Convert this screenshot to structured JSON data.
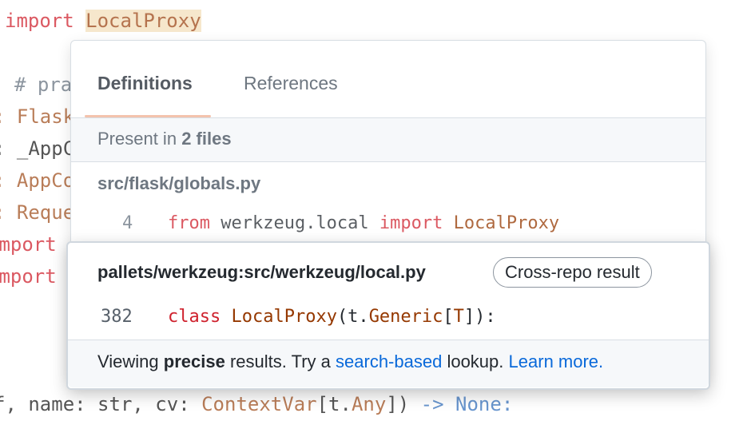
{
  "background_code": {
    "line1": {
      "kw": "import",
      "word": "LocalProxy"
    },
    "line2": "# pra",
    "line3": ": Flask",
    "line4": ": _AppC",
    "line5": ": AppCo",
    "line6": ": Reque",
    "line7": "import",
    "line8": "import",
    "line9_a": "f, name: str, cv: ",
    "line9_b": "ContextVar",
    "line9_c": "[t.",
    "line9_d": "Any",
    "line9_e": "]) ",
    "line9_f": "-> None:"
  },
  "popover": {
    "tabs": {
      "definitions": "Definitions",
      "references": "References"
    },
    "present": {
      "prefix": "Present in",
      "count": "2 files"
    },
    "file": "src/flask/globals.py",
    "def_line": {
      "number": "4",
      "kw1": "from",
      "module": "werkzeug.local",
      "kw2": "import",
      "name": "LocalProxy"
    }
  },
  "card": {
    "path": "pallets/werkzeug:src/werkzeug/local.py",
    "badge": "Cross-repo result",
    "line": {
      "number": "382",
      "kw": "class",
      "name": "LocalProxy",
      "p1": "(t.",
      "generic": "Generic",
      "p2": "[",
      "T": "T",
      "p3": "]):"
    },
    "footer": {
      "t1": "Viewing",
      "bold": "precise",
      "t2": "results. Try a",
      "link1": "search-based",
      "t3": "lookup.",
      "link2": "Learn more."
    }
  },
  "colors": {
    "link": "#0969da",
    "keyword": "#cf222e",
    "identifier": "#953800",
    "tab_underline": "#f3c3ad"
  }
}
